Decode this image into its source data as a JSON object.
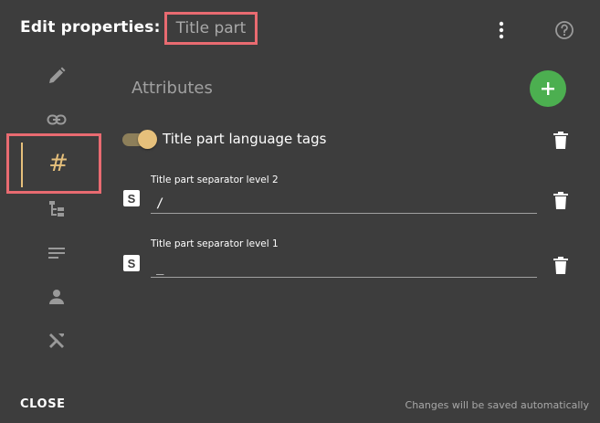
{
  "header": {
    "title": "Edit properties:",
    "entity_name": "Title part",
    "more_icon": "kebab-menu-icon",
    "help_icon": "help-circle-icon"
  },
  "sidebar": {
    "items": [
      {
        "icon": "pencil-icon",
        "active": false
      },
      {
        "icon": "link-icon",
        "active": false
      },
      {
        "icon": "hash-icon",
        "glyph": "#",
        "active": true
      },
      {
        "icon": "hierarchy-icon",
        "active": false
      },
      {
        "icon": "text-lines-icon",
        "active": false
      },
      {
        "icon": "person-icon",
        "active": false
      },
      {
        "icon": "tools-icon",
        "active": false
      }
    ]
  },
  "main": {
    "section_title": "Attributes",
    "add_button_icon": "plus-icon",
    "toggle": {
      "label": "Title part language tags",
      "on": true
    },
    "fields": [
      {
        "type_badge": "S",
        "label": "Title part separator level 2",
        "value": "/"
      },
      {
        "type_badge": "S",
        "label": "Title part separator level 1",
        "value": "_"
      }
    ]
  },
  "footer": {
    "close_label": "CLOSE",
    "autosave_note": "Changes will be saved automatically"
  },
  "colors": {
    "background": "#3d3d3d",
    "accent": "#e6c07b",
    "add_button": "#4caf50",
    "highlight_box": "#e96b71"
  }
}
